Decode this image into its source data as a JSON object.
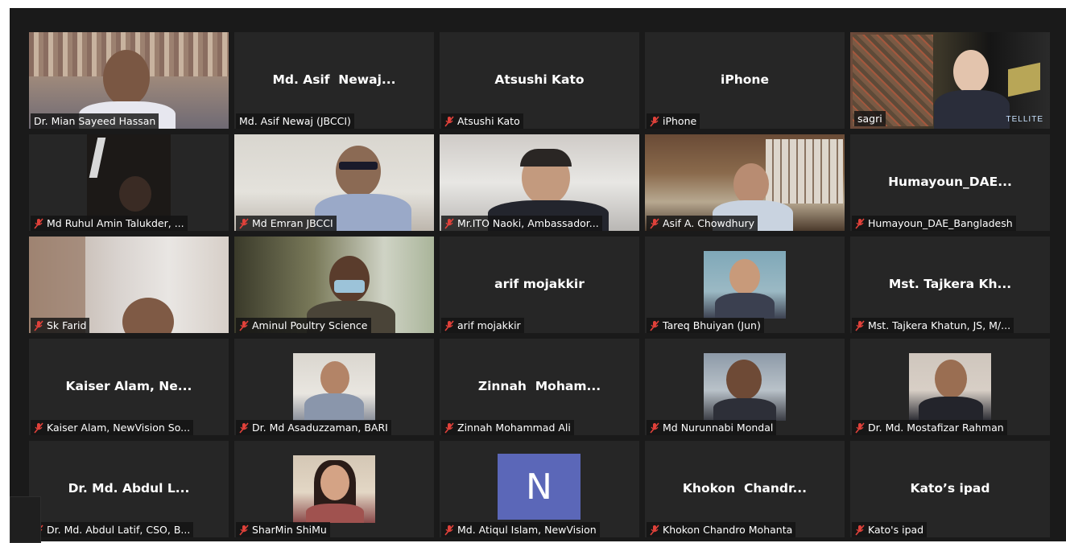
{
  "participants": [
    {
      "name": "Dr. Mian Sayeed Hassan",
      "display": "",
      "muted": false,
      "video": "office"
    },
    {
      "name": "Md. Asif Newaj (JBCCI)",
      "display": "Md. Asif  Newaj...",
      "muted": false,
      "video": "none"
    },
    {
      "name": "Atsushi Kato",
      "display": "Atsushi Kato",
      "muted": true,
      "video": "none"
    },
    {
      "name": "iPhone",
      "display": "iPhone",
      "muted": true,
      "video": "none"
    },
    {
      "name": "sagri",
      "display": "",
      "muted": false,
      "video": "satellite",
      "active_speaker": true
    },
    {
      "name": "Md Ruhul Amin Talukder, ...",
      "display": "",
      "muted": true,
      "video": "dark"
    },
    {
      "name": "Md Emran JBCCI",
      "display": "",
      "muted": true,
      "video": "room"
    },
    {
      "name": "Mr.ITO Naoki, Ambassador...",
      "display": "",
      "muted": true,
      "video": "gray"
    },
    {
      "name": "Asif A. Chowdhury",
      "display": "",
      "muted": true,
      "video": "shelf"
    },
    {
      "name": "Humayoun_DAE_Bangladesh",
      "display": "Humayoun_DAE...",
      "muted": true,
      "video": "none"
    },
    {
      "name": "Sk Farid",
      "display": "",
      "muted": true,
      "video": "blur"
    },
    {
      "name": "Aminul Poultry Science",
      "display": "",
      "muted": true,
      "video": "green"
    },
    {
      "name": "arif mojakkir",
      "display": "arif mojakkir",
      "muted": true,
      "video": "none"
    },
    {
      "name": "Tareq Bhuiyan (Jun)",
      "display": "",
      "muted": true,
      "video": "photo"
    },
    {
      "name": "Mst. Tajkera Khatun, JS, M/...",
      "display": "Mst. Tajkera Kh...",
      "muted": true,
      "video": "none"
    },
    {
      "name": "Kaiser Alam, NewVision So...",
      "display": "Kaiser Alam, Ne...",
      "muted": true,
      "video": "none"
    },
    {
      "name": "Dr. Md Asaduzzaman, BARI",
      "display": "",
      "muted": true,
      "video": "photo"
    },
    {
      "name": "Zinnah Mohammad Ali",
      "display": "Zinnah  Moham...",
      "muted": true,
      "video": "none"
    },
    {
      "name": "Md Nurunnabi Mondal",
      "display": "",
      "muted": true,
      "video": "photo"
    },
    {
      "name": "Dr. Md. Mostafizar Rahman",
      "display": "",
      "muted": true,
      "video": "photo"
    },
    {
      "name": "Dr. Md. Abdul Latif, CSO, B...",
      "display": "Dr. Md. Abdul L...",
      "muted": true,
      "video": "none"
    },
    {
      "name": "SharMin ShiMu",
      "display": "",
      "muted": true,
      "video": "photo"
    },
    {
      "name": "Md. Atiqul Islam, NewVision",
      "display": "",
      "muted": true,
      "video": "avatar",
      "avatar_letter": "N"
    },
    {
      "name": "Khokon Chandro Mohanta",
      "display": "Khokon  Chandr...",
      "muted": true,
      "video": "none"
    },
    {
      "name": "Kato's ipad",
      "display": "Kato’s ipad",
      "muted": true,
      "video": "none"
    }
  ],
  "sagri_overlay_text": "TELLITE",
  "colors": {
    "active_border": "#c9e265",
    "muted_icon": "#e0413a",
    "tile_bg": "#262626",
    "avatar_bg": "#5b67b8"
  }
}
